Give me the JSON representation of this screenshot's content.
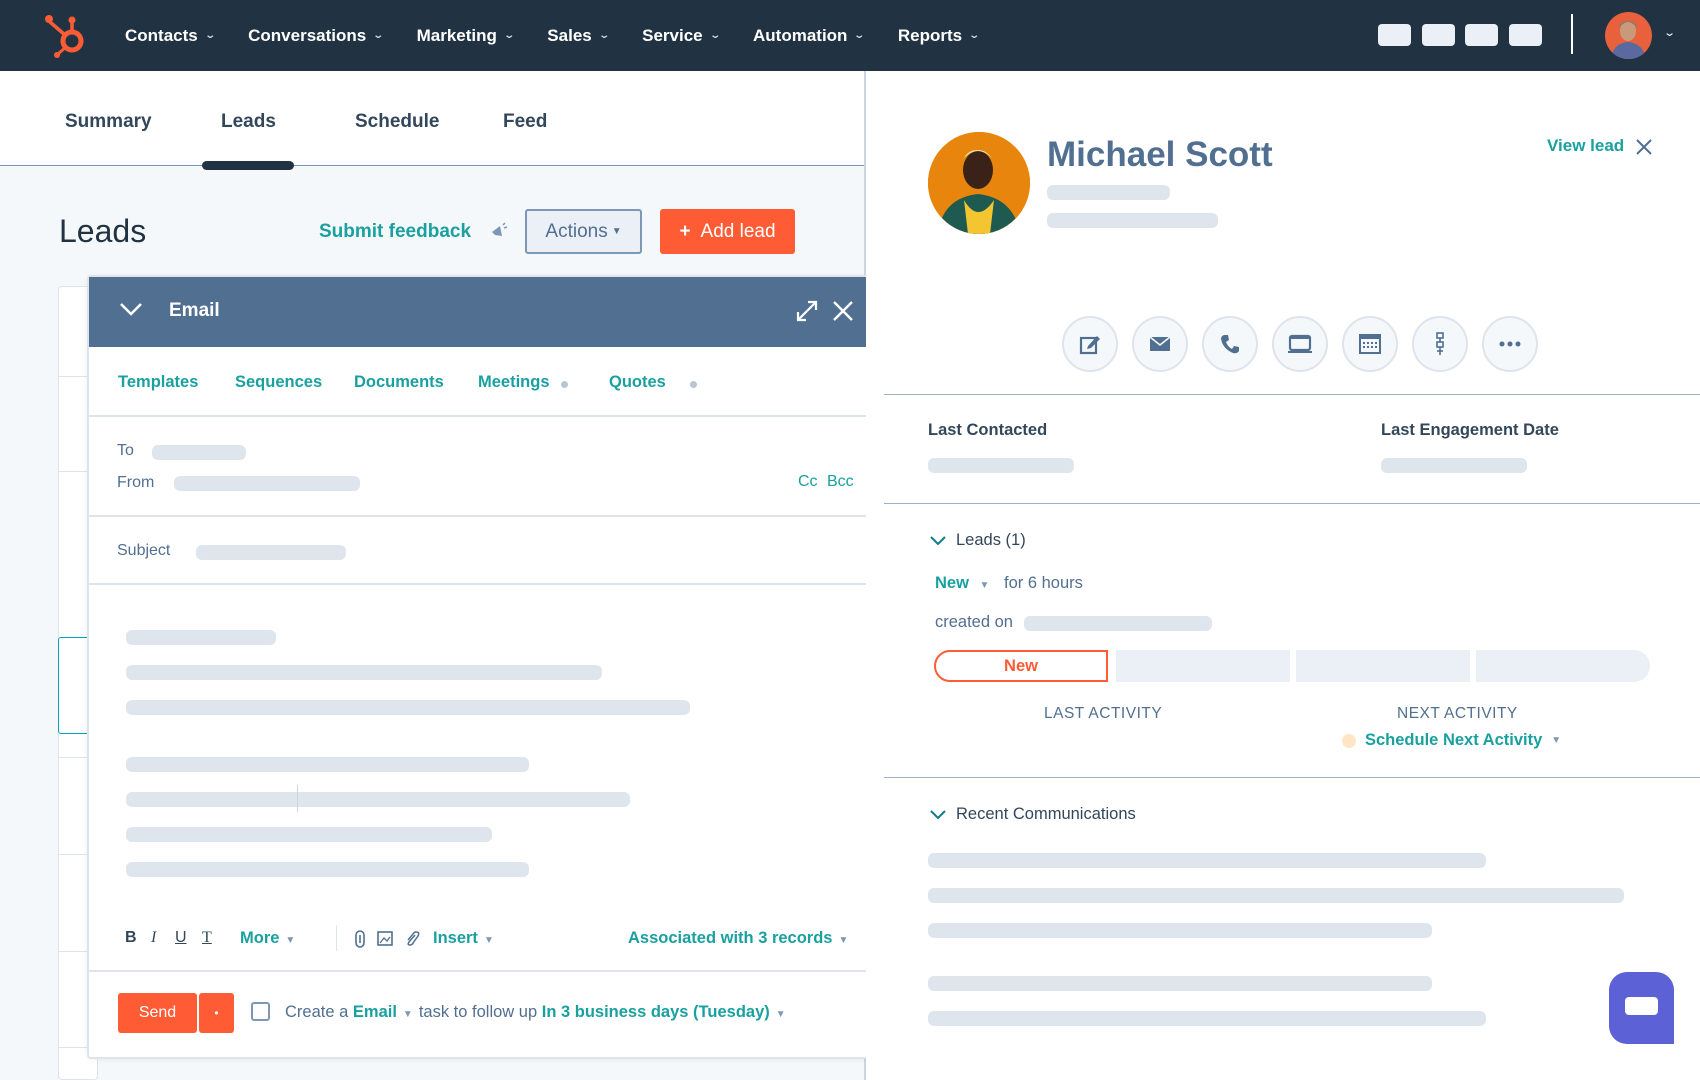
{
  "topnav": {
    "logo": "hubspot-sprocket-icon",
    "items": [
      {
        "label": "Contacts"
      },
      {
        "label": "Conversations"
      },
      {
        "label": "Marketing"
      },
      {
        "label": "Sales"
      },
      {
        "label": "Service"
      },
      {
        "label": "Automation"
      },
      {
        "label": "Reports"
      }
    ],
    "chevron": "⌄",
    "brand_color": "#ff5c35",
    "bg_color": "#213343"
  },
  "tabs": [
    {
      "label": "Summary",
      "active": false
    },
    {
      "label": "Leads",
      "active": true
    },
    {
      "label": "Schedule",
      "active": false
    },
    {
      "label": "Feed",
      "active": false
    }
  ],
  "leads_page": {
    "title": "Leads",
    "submit_feedback": "Submit feedback",
    "actions_label": "Actions",
    "add_lead_label": "Add lead",
    "add_icon": "+"
  },
  "composer": {
    "title": "Email",
    "tools": [
      "Templates",
      "Sequences",
      "Documents",
      "Meetings",
      "Quotes"
    ],
    "to_label": "To",
    "from_label": "From",
    "cc_label": "Cc",
    "bcc_label": "Bcc",
    "subject_label": "Subject",
    "toolbar": {
      "bold": "B",
      "italic": "I",
      "underline": "U",
      "clear_format": "T",
      "more": "More",
      "insert": "Insert",
      "associated": "Associated with 3 records"
    },
    "send_label": "Send",
    "send_more": "•",
    "task": {
      "prefix": "Create a",
      "type": "Email",
      "middle": "task to follow up",
      "due": "In 3 business days (Tuesday)",
      "checked": false
    }
  },
  "contact": {
    "name": "Michael Scott",
    "view_lead": "View lead",
    "actions": [
      "note-icon",
      "email-icon",
      "call-icon",
      "meeting-icon",
      "calendar-icon",
      "sequence-icon",
      "more-icon"
    ],
    "last_contacted_label": "Last Contacted",
    "last_engagement_label": "Last Engagement Date",
    "leads_section": {
      "title": "Leads (1)",
      "status": "New",
      "duration": "for 6 hours",
      "created_on": "created on",
      "stages": [
        "New",
        "",
        "",
        ""
      ],
      "current_stage": "New",
      "last_activity_label": "LAST ACTIVITY",
      "next_activity_label": "NEXT ACTIVITY",
      "schedule_next": "Schedule Next Activity"
    },
    "recent_comms_title": "Recent Communications"
  }
}
